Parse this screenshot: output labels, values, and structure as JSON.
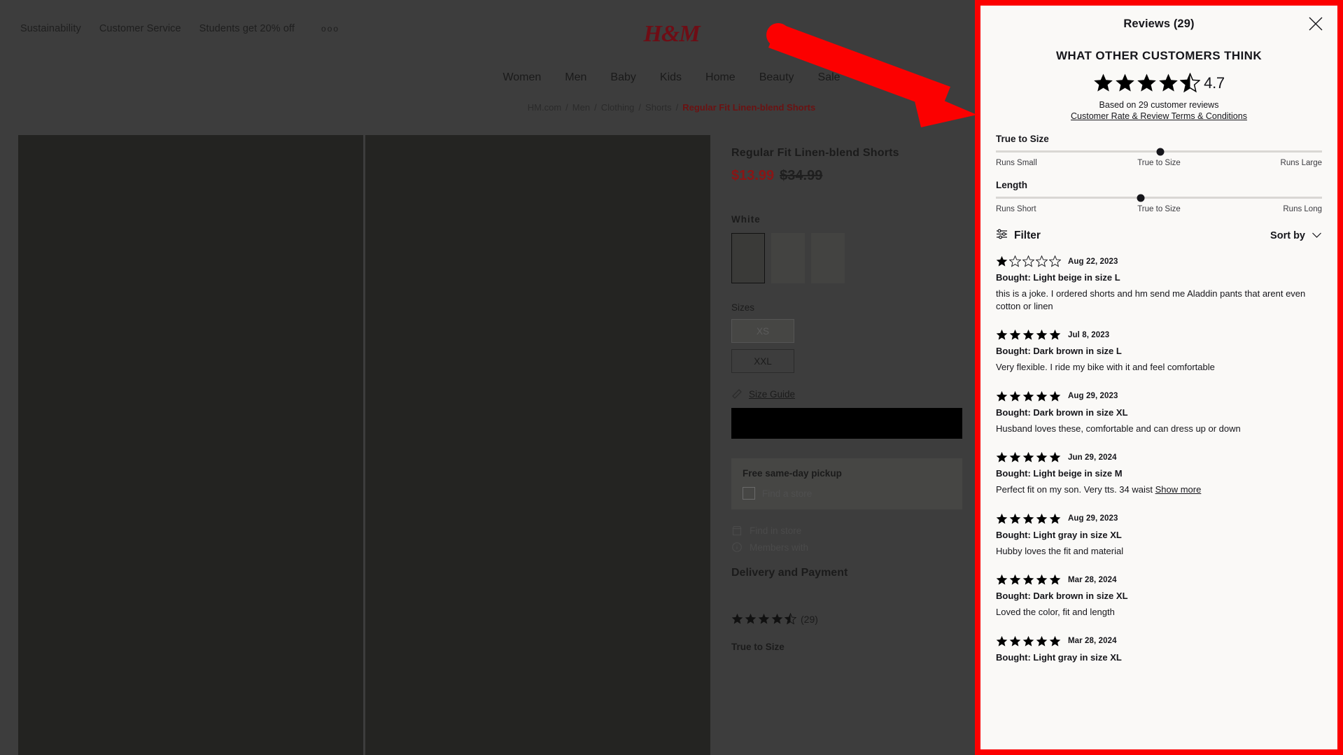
{
  "background": {
    "topbar": {
      "links": [
        "Sustainability",
        "Customer Service",
        "Students get 20% off"
      ],
      "overflow_icon": "ooo"
    },
    "logo": "H&M",
    "mainnav": [
      "Women",
      "Men",
      "Baby",
      "Kids",
      "Home",
      "Beauty",
      "Sale"
    ],
    "breadcrumb": {
      "items": [
        "HM.com",
        "Men",
        "Clothing",
        "Shorts"
      ],
      "separator": "/",
      "current": "Regular Fit Linen-blend Shorts"
    },
    "product": {
      "title": "Regular Fit Linen-blend Shorts",
      "price": "$13.99",
      "price_old": "$34.99",
      "color_label": "White",
      "sizes_label": "Sizes",
      "size_unavailable": "XS",
      "size_available": "XXL",
      "size_guide": "Size Guide",
      "size_guide_icon": "ruler-icon",
      "add_to_bag": "",
      "pickup_title": "Free same-day pickup",
      "pickup_find_store": "Find a store",
      "find_in_store": "Find in store",
      "find_in_store_icon": "store-icon",
      "members_note": "Members with",
      "members_icon": "info-icon",
      "delivery_title": "Delivery and Payment",
      "rating_count": "(29)",
      "true_to_size": "True to Size"
    }
  },
  "annotation": {
    "arrow_color": "#fc0000",
    "highlight_border_color": "#fc0000"
  },
  "drawer": {
    "title": "Reviews (29)",
    "close_icon": "close-icon",
    "heading": "WHAT OTHER CUSTOMERS THINK",
    "rating_value": "4.7",
    "rating_stars_full": 4,
    "rating_stars_half": true,
    "based_on": "Based on 29 customer reviews",
    "terms_link": "Customer Rate & Review Terms & Conditions",
    "fit_meters": [
      {
        "name": "True to Size",
        "left": "Runs Small",
        "mid": "True to Size",
        "right": "Runs Large",
        "position_pct": 50.5
      },
      {
        "name": "Length",
        "left": "Runs Short",
        "mid": "True to Size",
        "right": "Runs Long",
        "position_pct": 44.5
      }
    ],
    "filter_label": "Filter",
    "filter_icon": "filter-sliders-icon",
    "sort_label": "Sort by",
    "sort_icon": "chevron-down-icon",
    "reviews": [
      {
        "rating": 1,
        "date": "Aug 22, 2023",
        "bought": "Bought: Light beige in size L",
        "body": "this is a joke. I ordered shorts and hm send me Aladdin pants that arent even cotton or linen",
        "show_more": ""
      },
      {
        "rating": 5,
        "date": "Jul 8, 2023",
        "bought": "Bought: Dark brown in size L",
        "body": "Very flexible. I ride my bike with it and feel comfortable",
        "show_more": ""
      },
      {
        "rating": 5,
        "date": "Aug 29, 2023",
        "bought": "Bought: Dark brown in size XL",
        "body": "Husband loves these, comfortable and can dress up or down",
        "show_more": ""
      },
      {
        "rating": 5,
        "date": "Jun 29, 2024",
        "bought": "Bought: Light beige in size M",
        "body": "Perfect fit on my son. Very tts. 34 waist ",
        "show_more": "Show more"
      },
      {
        "rating": 5,
        "date": "Aug 29, 2023",
        "bought": "Bought: Light gray in size XL",
        "body": "Hubby loves the fit and material",
        "show_more": ""
      },
      {
        "rating": 5,
        "date": "Mar 28, 2024",
        "bought": "Bought: Dark brown in size XL",
        "body": "Loved the color, fit and length",
        "show_more": ""
      },
      {
        "rating": 5,
        "date": "Mar 28, 2024",
        "bought": "Bought: Light gray in size XL",
        "body": "",
        "show_more": ""
      }
    ]
  }
}
